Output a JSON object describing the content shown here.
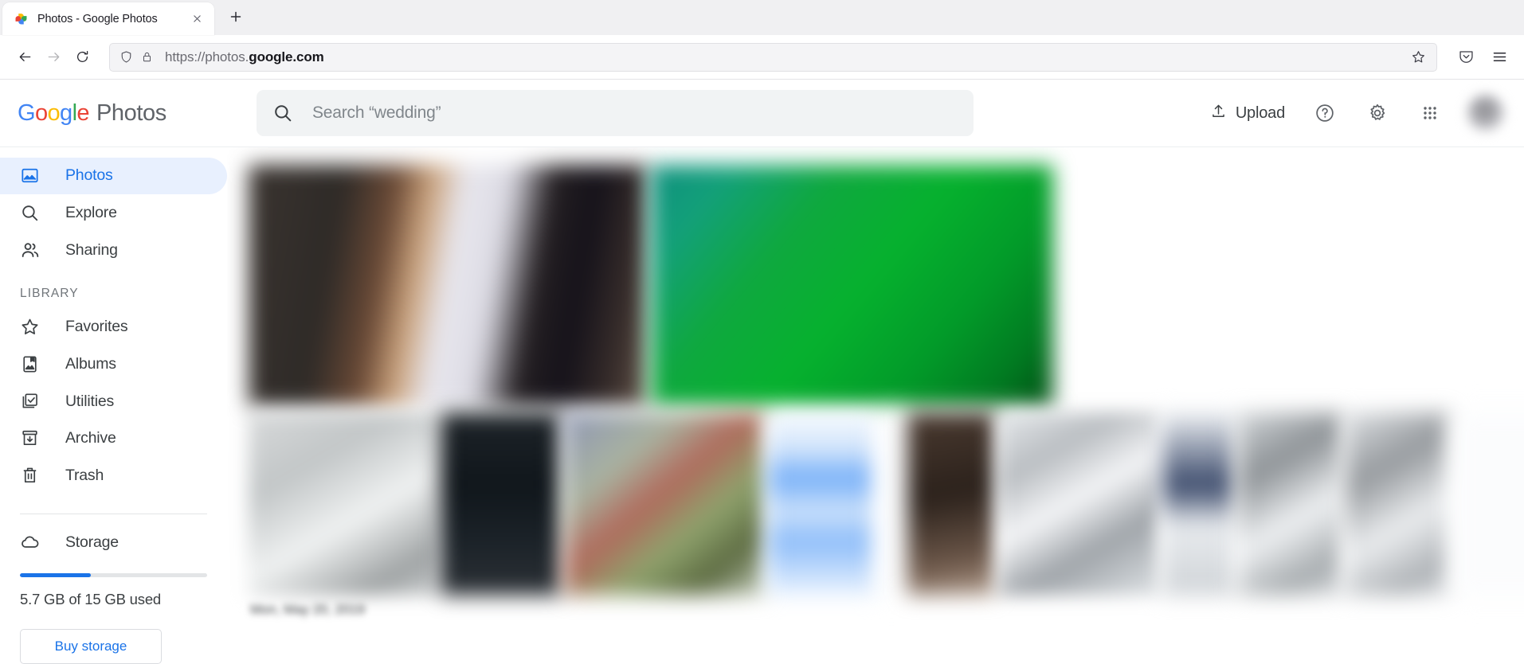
{
  "browser": {
    "tab": {
      "title": "Photos - Google Photos",
      "favicon": "google-photos-pinwheel-icon",
      "close_icon": "close-icon"
    },
    "new_tab_icon": "plus-icon",
    "nav": {
      "back_icon": "back-arrow-icon",
      "forward_icon": "forward-arrow-icon",
      "reload_icon": "reload-icon",
      "shield_icon": "shield-icon",
      "lock_icon": "lock-icon",
      "url_prefix": "https://photos.",
      "url_domain": "google.com",
      "bookmark_icon": "star-icon",
      "pocket_icon": "pocket-icon",
      "menu_icon": "hamburger-menu-icon"
    }
  },
  "header": {
    "logo": {
      "word": "Google",
      "letters": [
        "G",
        "o",
        "o",
        "g",
        "l",
        "e"
      ],
      "letter_colors": [
        "#4285F4",
        "#EA4335",
        "#FBBC05",
        "#4285F4",
        "#34A853",
        "#EA4335"
      ],
      "product": "Photos"
    },
    "search": {
      "icon": "search-icon",
      "placeholder": "Search “wedding”",
      "value": ""
    },
    "upload": {
      "label": "Upload",
      "icon": "upload-icon"
    },
    "help_icon": "help-circle-icon",
    "settings_icon": "gear-icon",
    "apps_icon": "apps-grid-icon",
    "avatar": "user-avatar"
  },
  "sidebar": {
    "primary": [
      {
        "label": "Photos",
        "icon": "photo-icon",
        "active": true
      },
      {
        "label": "Explore",
        "icon": "search-icon",
        "active": false
      },
      {
        "label": "Sharing",
        "icon": "people-icon",
        "active": false
      }
    ],
    "section_label": "LIBRARY",
    "library": [
      {
        "label": "Favorites",
        "icon": "star-outline-icon"
      },
      {
        "label": "Albums",
        "icon": "album-icon"
      },
      {
        "label": "Utilities",
        "icon": "utilities-checkbox-icon"
      },
      {
        "label": "Archive",
        "icon": "archive-box-icon"
      },
      {
        "label": "Trash",
        "icon": "trash-icon"
      }
    ],
    "storage": {
      "label": "Storage",
      "icon": "cloud-icon",
      "used_percent": 38,
      "usage_text": "5.7 GB of 15 GB used",
      "buy_label": "Buy storage",
      "accent_color": "#1a73e8"
    }
  },
  "content": {
    "groups": [
      {
        "date_label": "",
        "rows": [
          [
            {
              "id": "p1",
              "alt": "blurred-photo"
            },
            {
              "id": "p2",
              "alt": "blurred-photo"
            }
          ]
        ]
      },
      {
        "date_label": "Mon, May 20, 2019",
        "rows": [
          [
            {
              "id": "q1",
              "alt": "blurred-photo"
            },
            {
              "id": "q2",
              "alt": "blurred-photo"
            },
            {
              "id": "q3",
              "alt": "blurred-photo"
            },
            {
              "id": "q4",
              "alt": "blurred-photo"
            },
            {
              "id": "q5",
              "alt": "blurred-photo"
            },
            {
              "id": "q6",
              "alt": "blurred-photo"
            },
            {
              "id": "q7",
              "alt": "blurred-photo"
            },
            {
              "id": "q8",
              "alt": "blurred-photo"
            },
            {
              "id": "q9",
              "alt": "blurred-photo"
            },
            {
              "id": "q10",
              "alt": "blurred-photo"
            },
            {
              "id": "q11",
              "alt": "blurred-photo"
            },
            {
              "id": "q12",
              "alt": "blurred-photo"
            }
          ]
        ]
      }
    ]
  }
}
